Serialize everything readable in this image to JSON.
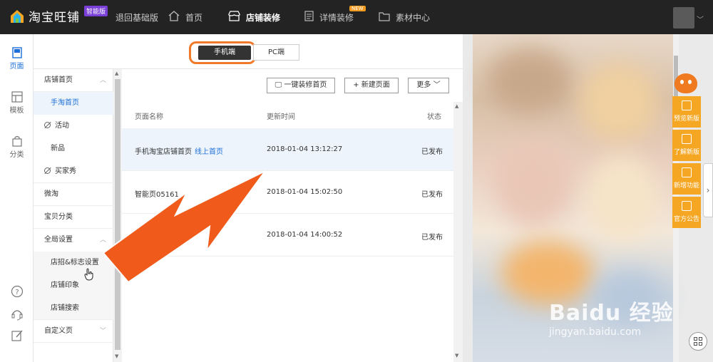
{
  "topbar": {
    "app_name": "淘宝旺铺",
    "badge": "智能版",
    "back_link": "退回基础版",
    "nav": [
      {
        "label": "首页",
        "icon": "home-icon"
      },
      {
        "label": "店铺装修",
        "icon": "store-icon",
        "active": true
      },
      {
        "label": "详情装修",
        "icon": "document-icon",
        "tag": "NEW"
      },
      {
        "label": "素材中心",
        "icon": "folder-icon"
      }
    ]
  },
  "rail": [
    {
      "label": "页面",
      "icon": "page-icon",
      "active": true
    },
    {
      "label": "模板",
      "icon": "template-icon"
    },
    {
      "label": "分类",
      "icon": "bag-icon"
    }
  ],
  "tabs": {
    "mobile": "手机端",
    "pc": "PC端"
  },
  "sidebar": {
    "items": [
      {
        "label": "店铺首页",
        "type": "group",
        "caret": "up"
      },
      {
        "label": "手淘首页",
        "type": "sub",
        "selected": true
      },
      {
        "label": "活动",
        "type": "hidden"
      },
      {
        "label": "新品",
        "type": "plain"
      },
      {
        "label": "买家秀",
        "type": "hidden"
      },
      {
        "label": "微淘",
        "type": "group"
      },
      {
        "label": "宝贝分类",
        "type": "group"
      },
      {
        "label": "全局设置",
        "type": "group",
        "caret": "up"
      },
      {
        "label": "店招&标志设置",
        "type": "sub"
      },
      {
        "label": "店铺印象",
        "type": "sub"
      },
      {
        "label": "店铺搜索",
        "type": "sub"
      },
      {
        "label": "自定义页",
        "type": "group",
        "caret": "down"
      }
    ]
  },
  "toolbar": {
    "one_click": "一键装修首页",
    "new_page": "新建页面",
    "more": "更多"
  },
  "table": {
    "headers": {
      "name": "页面名称",
      "time": "更新时间",
      "status": "状态"
    },
    "rows": [
      {
        "name": "手机淘宝店铺首页",
        "tag": "线上首页",
        "time": "2018-01-04 13:12:27",
        "status": "已发布"
      },
      {
        "name": "智能页05161",
        "time": "2018-01-04 15:02:50",
        "status": "已发布"
      },
      {
        "name": "",
        "time": "2018-01-04 14:00:52",
        "status": "已发布"
      }
    ]
  },
  "tools": [
    {
      "label": "预览新版",
      "icon": "qr-icon"
    },
    {
      "label": "了解新版",
      "icon": "new-icon"
    },
    {
      "label": "新增功能",
      "icon": "doc-icon"
    },
    {
      "label": "官方公告",
      "icon": "notice-icon"
    }
  ],
  "mascot_label": "客小蜜",
  "watermark": {
    "main": "Baidu 经验",
    "sub": "jingyan.baidu.com"
  },
  "colors": {
    "accent": "#1d6fd8",
    "topbar": "#232323",
    "orange": "#f5a623",
    "highlight": "#f07a2a"
  }
}
